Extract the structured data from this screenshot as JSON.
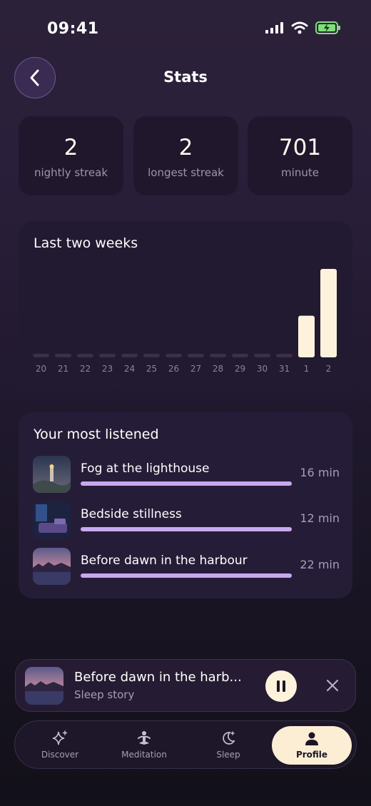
{
  "status_bar": {
    "time": "09:41"
  },
  "header": {
    "title": "Stats",
    "back_icon": "chevron-left-icon"
  },
  "stats": [
    {
      "value": "2",
      "label": "nightly streak"
    },
    {
      "value": "2",
      "label": "longest streak"
    },
    {
      "value": "701",
      "label": "minute"
    }
  ],
  "chart_data": {
    "type": "bar",
    "title": "Last two weeks",
    "categories": [
      "20",
      "21",
      "22",
      "23",
      "24",
      "25",
      "26",
      "27",
      "28",
      "29",
      "30",
      "31",
      "1",
      "2"
    ],
    "values": [
      0,
      0,
      0,
      0,
      0,
      0,
      0,
      0,
      0,
      0,
      0,
      0,
      16,
      34
    ],
    "colors": {
      "empty": "#3a3049",
      "filled": "#fdf3dd",
      "label": "#8d8299"
    }
  },
  "most_listened": {
    "title": "Your most listened",
    "items": [
      {
        "name": "Fog at the lighthouse",
        "minutes": "16 min",
        "progress": 1.0
      },
      {
        "name": "Bedside stillness",
        "minutes": "12 min",
        "progress": 1.0
      },
      {
        "name": "Before dawn in the harbour",
        "minutes": "22 min",
        "progress": 1.0
      }
    ]
  },
  "player": {
    "title": "Before dawn in the harb...",
    "subtitle": "Sleep story",
    "pause_icon": "pause-icon",
    "close_icon": "close-icon"
  },
  "tabs": [
    {
      "label": "Discover",
      "icon": "sparkle-icon",
      "active": false
    },
    {
      "label": "Meditation",
      "icon": "meditation-icon",
      "active": false
    },
    {
      "label": "Sleep",
      "icon": "moon-icon",
      "active": false
    },
    {
      "label": "Profile",
      "icon": "person-icon",
      "active": true
    }
  ]
}
